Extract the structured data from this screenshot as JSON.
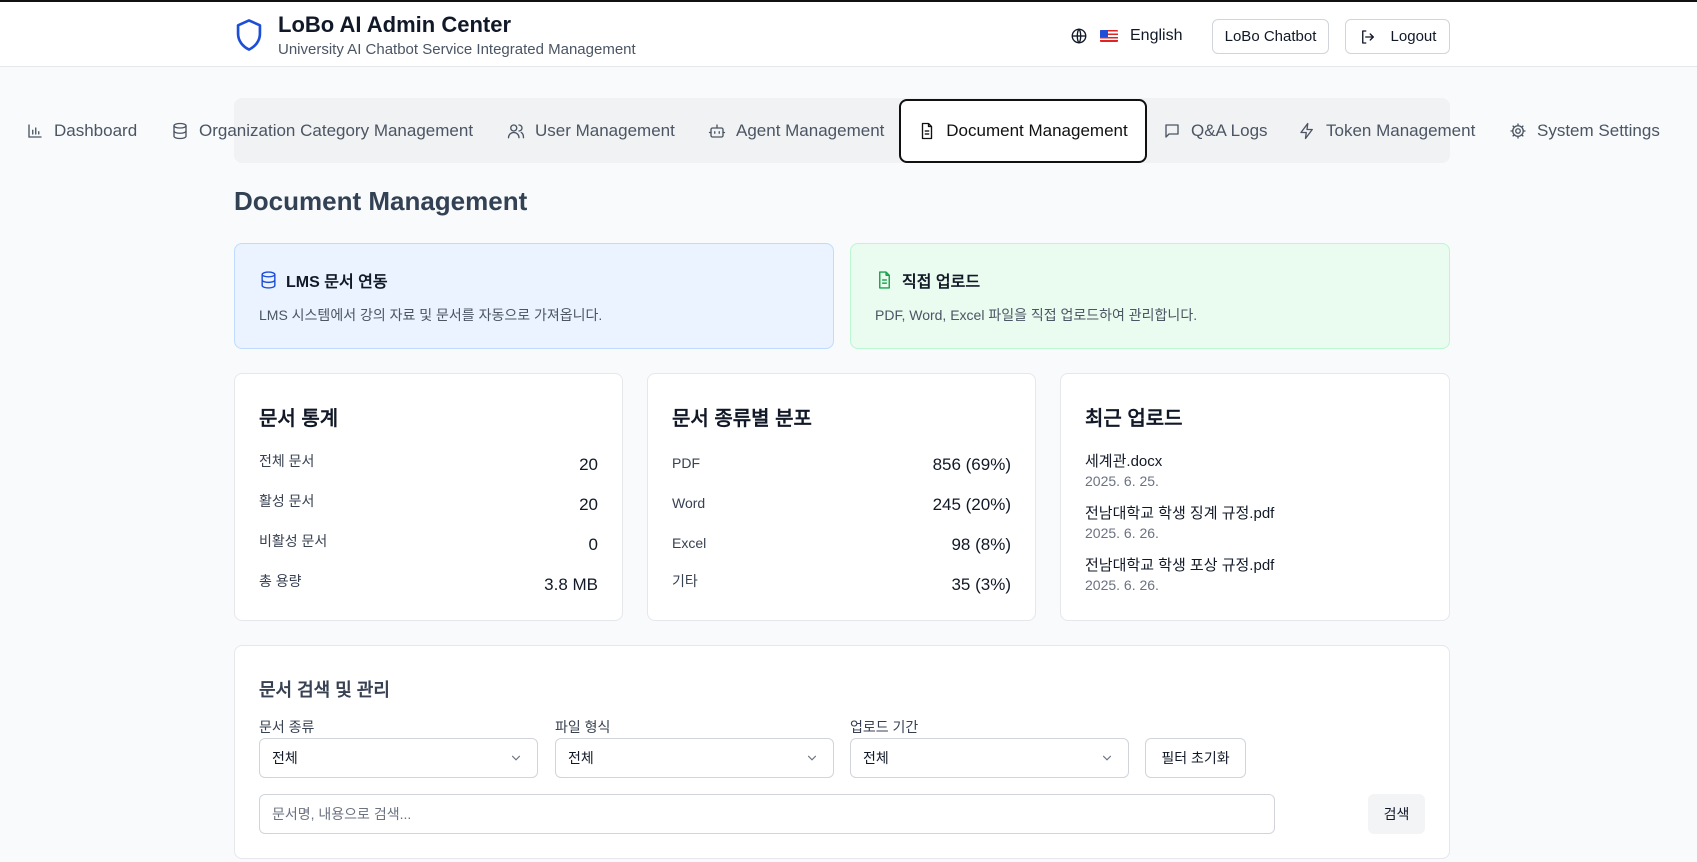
{
  "header": {
    "title": "LoBo AI Admin Center",
    "subtitle": "University AI Chatbot Service Integrated Management",
    "language": "English",
    "chatbot_label": "LoBo Chatbot",
    "logout_label": "Logout",
    "brand_color": "#1d4ed8"
  },
  "nav": {
    "tabs": [
      {
        "label": "Dashboard",
        "icon": "bar-chart-icon"
      },
      {
        "label": "Organization Category Management",
        "icon": "database-icon"
      },
      {
        "label": "User Management",
        "icon": "users-icon"
      },
      {
        "label": "Agent Management",
        "icon": "bot-icon"
      },
      {
        "label": "Document Management",
        "icon": "file-text-icon",
        "active": true
      },
      {
        "label": "Q&A Logs",
        "icon": "message-square-icon"
      },
      {
        "label": "Token Management",
        "icon": "zap-icon"
      },
      {
        "label": "System Settings",
        "icon": "gear-icon"
      }
    ]
  },
  "page": {
    "title": "Document Management"
  },
  "banners": {
    "lms": {
      "title": "LMS 문서 연동",
      "description": "LMS 시스템에서 강의 자료 및 문서를 자동으로 가져옵니다.",
      "color": "#1d4ed8"
    },
    "upload": {
      "title": "직접 업로드",
      "description": "PDF, Word, Excel 파일을 직접 업로드하여 관리합니다.",
      "color": "#16a34a"
    }
  },
  "stats": {
    "title": "문서 통계",
    "rows": [
      {
        "label": "전체 문서",
        "value": "20"
      },
      {
        "label": "활성 문서",
        "value": "20"
      },
      {
        "label": "비활성 문서",
        "value": "0"
      },
      {
        "label": "총 용량",
        "value": "3.8 MB"
      }
    ]
  },
  "distribution": {
    "title": "문서 종류별 분포",
    "rows": [
      {
        "label": "PDF",
        "value": "856 (69%)"
      },
      {
        "label": "Word",
        "value": "245 (20%)"
      },
      {
        "label": "Excel",
        "value": "98 (8%)"
      },
      {
        "label": "기타",
        "value": "35 (3%)"
      }
    ]
  },
  "recent": {
    "title": "최근 업로드",
    "items": [
      {
        "name": "세계관.docx",
        "date": "2025. 6. 25."
      },
      {
        "name": "전남대학교 학생 징계 규정.pdf",
        "date": "2025. 6. 26."
      },
      {
        "name": "전남대학교 학생 포상 규정.pdf",
        "date": "2025. 6. 26."
      }
    ]
  },
  "search": {
    "title": "문서 검색 및 관리",
    "filters": [
      {
        "label": "문서 종류",
        "value": "전체"
      },
      {
        "label": "파일 형식",
        "value": "전체"
      },
      {
        "label": "업로드 기간",
        "value": "전체"
      }
    ],
    "reset_label": "필터 초기화",
    "placeholder": "문서명, 내용으로 검색...",
    "search_label": "검색"
  }
}
